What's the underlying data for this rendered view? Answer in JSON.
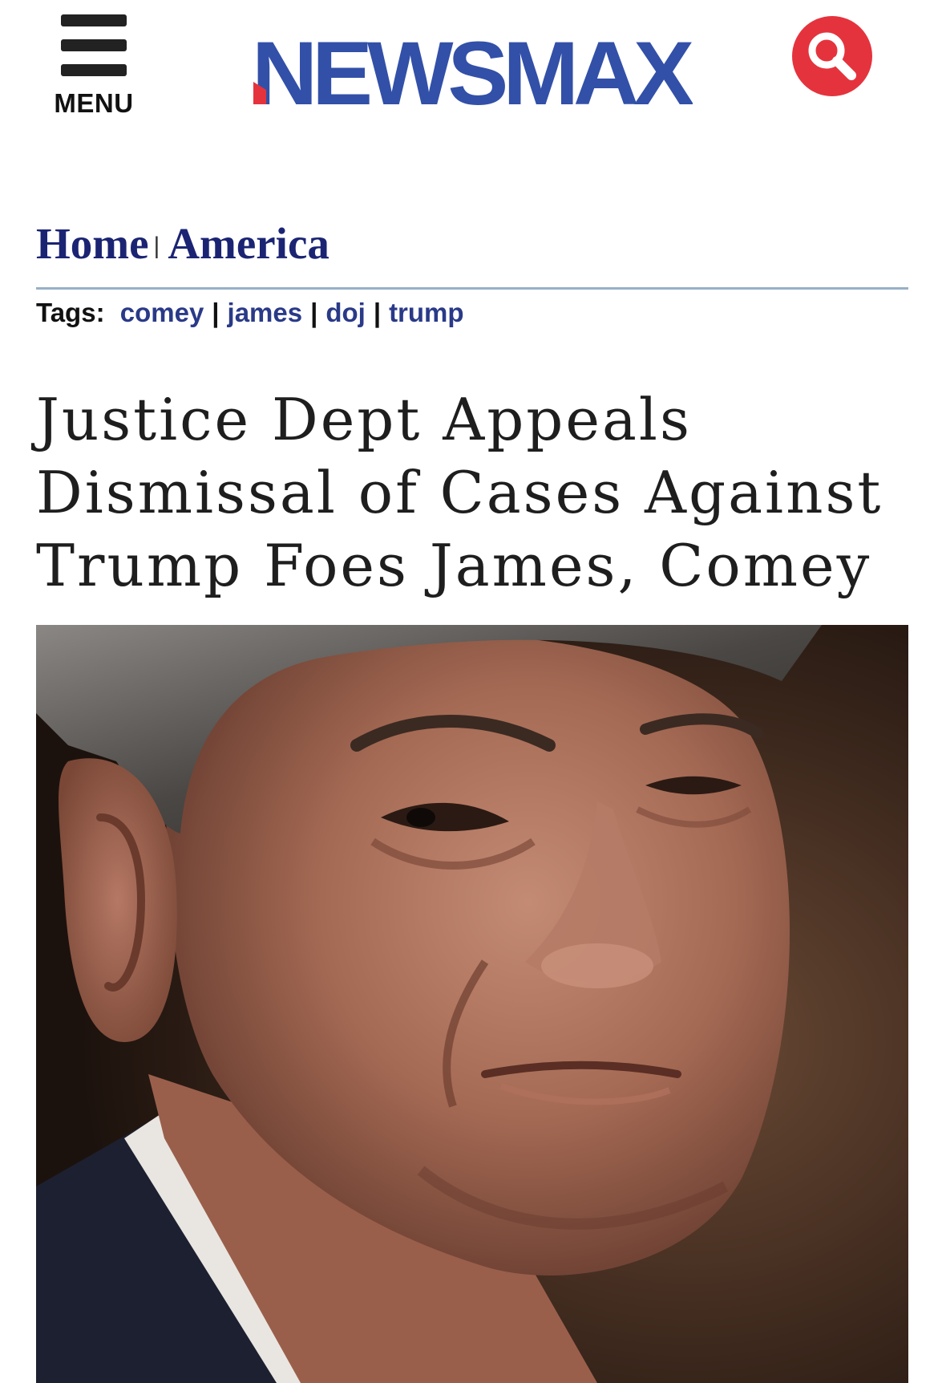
{
  "header": {
    "menu_label": "MENU",
    "logo_text": "NEWSMAX",
    "logo_colors": {
      "blue": "#3250a8",
      "red": "#e5333d"
    },
    "search_icon": "search-icon"
  },
  "breadcrumb": {
    "items": [
      "Home",
      "America"
    ],
    "separator": "|"
  },
  "tags": {
    "label": "Tags:",
    "items": [
      "comey",
      "james",
      "doj",
      "trump"
    ]
  },
  "article": {
    "headline_lines": [
      "Justice Dept Appeals",
      "Dismissal of Cases Against",
      "Trump Foes James, Comey"
    ],
    "hero_image": "close-up-portrait-photo"
  },
  "colors": {
    "breadcrumb": "#1b2473",
    "tag_link": "#2a3a88",
    "divider": "#98b0c8",
    "search_button": "#e5333d"
  }
}
